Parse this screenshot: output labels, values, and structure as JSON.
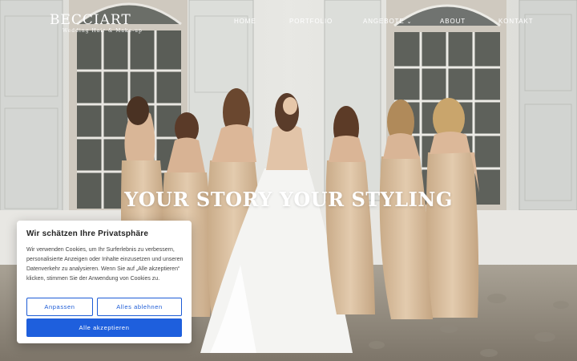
{
  "brand": {
    "name": "BECCIART",
    "tagline": "Wedding Hair & Make-up"
  },
  "nav": {
    "items": [
      {
        "label": "HOME"
      },
      {
        "label": "PORTFOLIO"
      },
      {
        "label": "ANGEBOTE",
        "has_dropdown": true
      },
      {
        "label": "ABOUT"
      },
      {
        "label": "KONTAKT"
      }
    ],
    "dropdown_icon": "chevron-down-icon"
  },
  "hero": {
    "headline": "YOUR STORY YOUR STYLING"
  },
  "cookie_banner": {
    "title": "Wir schätzen Ihre Privatsphäre",
    "text": "Wir verwenden Cookies, um Ihr Surferlebnis zu verbessern, personalisierte Anzeigen oder Inhalte einzusetzen und unseren Datenverkehr zu analysieren. Wenn Sie auf „Alle akzeptieren“ klicken, stimmen Sie der Anwendung von Cookies zu.",
    "customize_label": "Anpassen",
    "reject_label": "Alles ablehnen",
    "accept_label": "Alle akzeptieren"
  },
  "colors": {
    "accent": "#1e5fdd",
    "header_text": "#ffffff",
    "dress_satin": "#d8bea0",
    "gown": "#f4f4f2"
  }
}
